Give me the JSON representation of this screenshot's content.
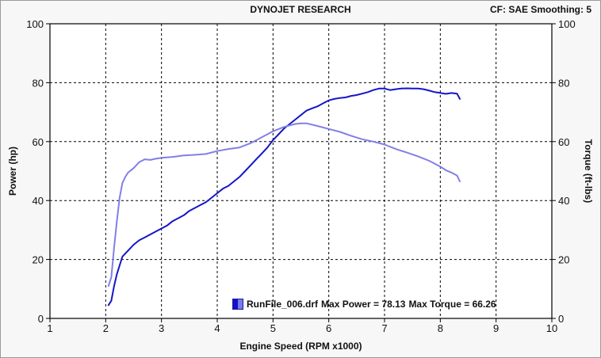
{
  "header": {
    "title": "DYNOJET RESEARCH",
    "info": "CF: SAE  Smoothing: 5"
  },
  "legend": {
    "run_file": "RunFile_006.drf",
    "max_power_text": "Max Power = 78.13",
    "max_torque_text": "Max Torque = 66.26"
  },
  "colors": {
    "power": "#1515c8",
    "torque": "#8080e6",
    "grid": "#000000",
    "plot_bg": "#ffffff"
  },
  "chart_data": {
    "type": "line",
    "title": "DYNOJET RESEARCH",
    "xlabel": "Engine Speed (RPM x1000)",
    "ylabel": "Power (hp)",
    "y2label": "Torque (ft-lbs)",
    "xlim": [
      1,
      10
    ],
    "ylim": [
      0,
      100
    ],
    "y2lim": [
      0,
      100
    ],
    "x_ticks": [
      1,
      2,
      3,
      4,
      5,
      6,
      7,
      8,
      9,
      10
    ],
    "y_ticks": [
      0,
      20,
      40,
      60,
      80,
      100
    ],
    "y2_ticks": [
      0,
      20,
      40,
      60,
      80,
      100
    ],
    "grid": true,
    "legend_position": "bottom-center",
    "series": [
      {
        "name": "Power",
        "axis": "left",
        "points": [
          [
            2.05,
            4.5
          ],
          [
            2.1,
            6
          ],
          [
            2.15,
            11
          ],
          [
            2.2,
            15
          ],
          [
            2.25,
            18
          ],
          [
            2.3,
            21
          ],
          [
            2.4,
            23
          ],
          [
            2.5,
            25
          ],
          [
            2.6,
            26.5
          ],
          [
            2.7,
            27.5
          ],
          [
            2.8,
            28.5
          ],
          [
            2.9,
            29.5
          ],
          [
            3.0,
            30.5
          ],
          [
            3.1,
            31.5
          ],
          [
            3.2,
            33
          ],
          [
            3.3,
            34
          ],
          [
            3.4,
            35
          ],
          [
            3.5,
            36.5
          ],
          [
            3.6,
            37.5
          ],
          [
            3.7,
            38.5
          ],
          [
            3.8,
            39.5
          ],
          [
            3.9,
            41
          ],
          [
            4.0,
            42.5
          ],
          [
            4.1,
            44
          ],
          [
            4.2,
            45
          ],
          [
            4.3,
            46.5
          ],
          [
            4.4,
            48
          ],
          [
            4.5,
            50
          ],
          [
            4.6,
            52
          ],
          [
            4.7,
            54
          ],
          [
            4.8,
            56
          ],
          [
            4.9,
            58
          ],
          [
            5.0,
            60.5
          ],
          [
            5.1,
            62.5
          ],
          [
            5.2,
            64.5
          ],
          [
            5.3,
            66
          ],
          [
            5.4,
            67.5
          ],
          [
            5.5,
            69
          ],
          [
            5.6,
            70.5
          ],
          [
            5.7,
            71.3
          ],
          [
            5.8,
            72
          ],
          [
            5.9,
            73
          ],
          [
            6.0,
            74
          ],
          [
            6.1,
            74.5
          ],
          [
            6.2,
            74.8
          ],
          [
            6.3,
            75
          ],
          [
            6.4,
            75.5
          ],
          [
            6.5,
            75.8
          ],
          [
            6.6,
            76.3
          ],
          [
            6.7,
            76.8
          ],
          [
            6.8,
            77.5
          ],
          [
            6.9,
            78
          ],
          [
            7.0,
            78
          ],
          [
            7.1,
            77.5
          ],
          [
            7.2,
            77.8
          ],
          [
            7.3,
            78
          ],
          [
            7.4,
            78.1
          ],
          [
            7.5,
            78
          ],
          [
            7.6,
            78
          ],
          [
            7.7,
            77.8
          ],
          [
            7.8,
            77.3
          ],
          [
            7.9,
            76.8
          ],
          [
            8.0,
            76.5
          ],
          [
            8.1,
            76.2
          ],
          [
            8.2,
            76.5
          ],
          [
            8.3,
            76.3
          ],
          [
            8.35,
            74.5
          ]
        ]
      },
      {
        "name": "Torque",
        "axis": "right",
        "points": [
          [
            2.05,
            11
          ],
          [
            2.1,
            14
          ],
          [
            2.15,
            24
          ],
          [
            2.2,
            33
          ],
          [
            2.25,
            41
          ],
          [
            2.3,
            46
          ],
          [
            2.35,
            48
          ],
          [
            2.4,
            49.5
          ],
          [
            2.5,
            51
          ],
          [
            2.6,
            53
          ],
          [
            2.7,
            54
          ],
          [
            2.8,
            53.8
          ],
          [
            2.9,
            54.2
          ],
          [
            3.0,
            54.5
          ],
          [
            3.2,
            54.8
          ],
          [
            3.4,
            55.3
          ],
          [
            3.6,
            55.5
          ],
          [
            3.8,
            55.8
          ],
          [
            4.0,
            56.8
          ],
          [
            4.2,
            57.5
          ],
          [
            4.4,
            58
          ],
          [
            4.6,
            59.5
          ],
          [
            4.8,
            61.5
          ],
          [
            5.0,
            63.5
          ],
          [
            5.2,
            65
          ],
          [
            5.4,
            66
          ],
          [
            5.5,
            66.2
          ],
          [
            5.6,
            66.2
          ],
          [
            5.8,
            65.3
          ],
          [
            6.0,
            64.3
          ],
          [
            6.2,
            63.3
          ],
          [
            6.4,
            62
          ],
          [
            6.6,
            60.8
          ],
          [
            6.8,
            60
          ],
          [
            7.0,
            59
          ],
          [
            7.2,
            57.5
          ],
          [
            7.4,
            56.3
          ],
          [
            7.6,
            55
          ],
          [
            7.8,
            53.5
          ],
          [
            8.0,
            51.5
          ],
          [
            8.1,
            50.3
          ],
          [
            8.2,
            49.5
          ],
          [
            8.3,
            48.5
          ],
          [
            8.35,
            46.5
          ]
        ]
      }
    ]
  }
}
